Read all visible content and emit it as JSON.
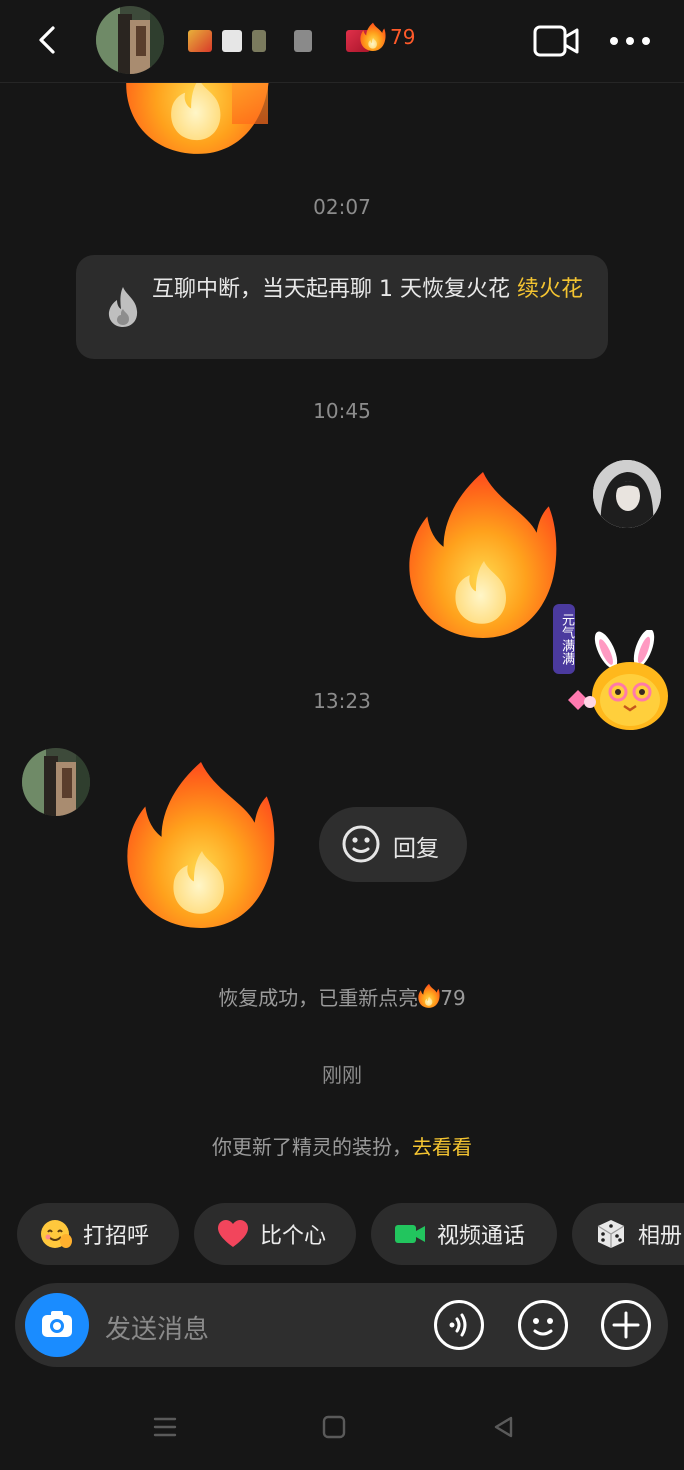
{
  "header": {
    "streak_count": "79"
  },
  "times": {
    "t1": "02:07",
    "t2": "10:45",
    "t3": "13:23",
    "t4": "刚刚"
  },
  "notice": {
    "text": "互聊中断，当天起再聊 1 天恢复火花",
    "link": "续火花"
  },
  "sticker_label": "元气满满",
  "reply_button": {
    "label": "回复"
  },
  "system": {
    "restored_text": "恢复成功，已重新点亮",
    "restored_count": "79",
    "outfit_text": "你更新了精灵的装扮，",
    "outfit_link": "去看看"
  },
  "quick_actions": [
    {
      "label": "打招呼",
      "icon": "greeting-emoji-icon"
    },
    {
      "label": "比个心",
      "icon": "heart-icon"
    },
    {
      "label": "视频通话",
      "icon": "video-call-icon"
    },
    {
      "label": "相册",
      "icon": "dice-icon"
    }
  ],
  "input": {
    "placeholder": "发送消息"
  },
  "colors": {
    "background": "#161616",
    "accent_yellow": "#f4c431",
    "streak_red": "#ff5a2a",
    "camera_blue": "#1a8cff"
  }
}
